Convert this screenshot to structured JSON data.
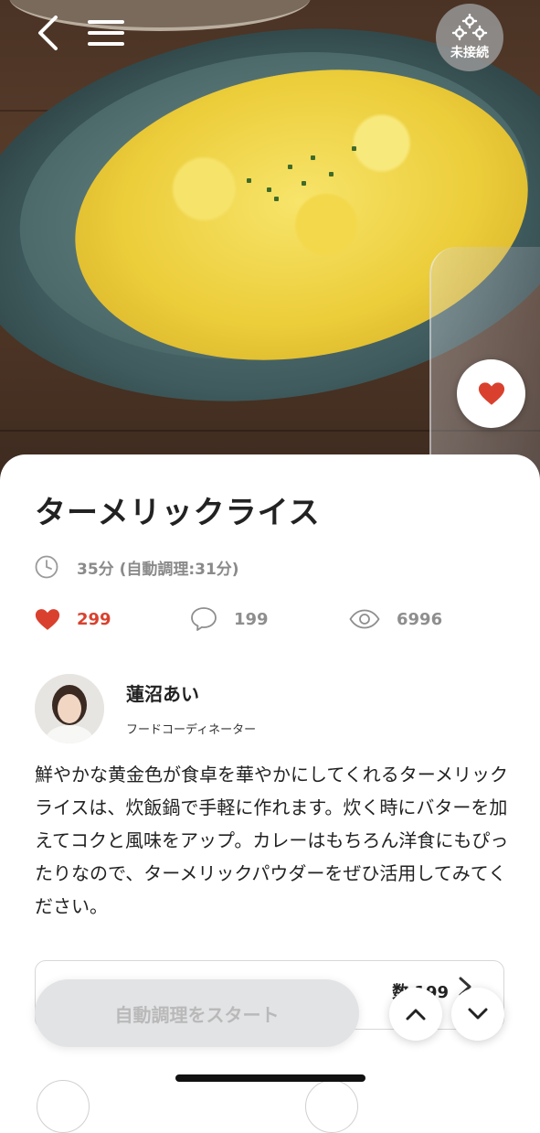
{
  "header": {
    "back_icon": "chevron-left-icon",
    "menu_icon": "hamburger-menu-icon",
    "connection_status": "未接続",
    "connection_icon": "gears-icon"
  },
  "recipe": {
    "title": "ターメリックライス",
    "time": "35分 (自動調理:31分)",
    "likes": "299",
    "comments": "199",
    "views": "6996",
    "like_color": "#d9412e"
  },
  "author": {
    "name": "蓮沼あい",
    "role": "フードコーディネーター"
  },
  "description": "鮮やかな黄金色が食卓を華やかにしてくれるターメリックライスは、炊飯鍋で手軽に作れます。炊く時にバターを加えてコクと風味をアップ。カレーはもちろん洋食にもぴったりなので、ターメリックパウダーをぜひ活用してみてください。",
  "info_box": {
    "text": "数 199"
  },
  "actions": {
    "start_label": "自動調理をスタート",
    "scroll_up_icon": "chevron-up-icon",
    "scroll_down_icon": "chevron-down-icon"
  }
}
